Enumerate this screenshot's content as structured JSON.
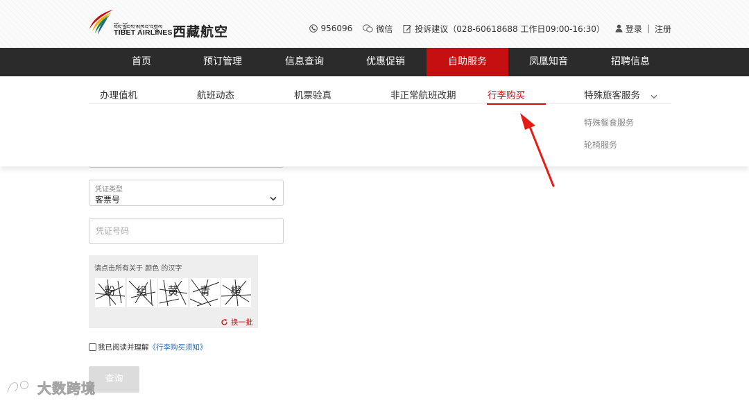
{
  "header": {
    "logo_tibetan": "བོད་ལྗོངས་མཁའ་འགྲུལ",
    "logo_en": "TIBET AIRLINES",
    "logo_cn": "西藏航空",
    "phone": "956096",
    "wechat": "微信",
    "complaint": "投诉建议（028-60618688 工作日09:00-16:30）",
    "login": "登录",
    "separator": "|",
    "register": "注册"
  },
  "nav": {
    "items": [
      {
        "label": "首页"
      },
      {
        "label": "预订管理"
      },
      {
        "label": "信息查询"
      },
      {
        "label": "优惠促销"
      },
      {
        "label": "自助服务"
      },
      {
        "label": "凤凰知音"
      },
      {
        "label": "招聘信息"
      }
    ],
    "active_index": 4
  },
  "subnav": {
    "items": [
      {
        "label": "办理值机"
      },
      {
        "label": "航班动态"
      },
      {
        "label": "机票验真"
      },
      {
        "label": "非正常航班改期"
      },
      {
        "label": "行李购买"
      },
      {
        "label": "特殊旅客服务"
      }
    ],
    "active_index": 4,
    "special_children": [
      "特殊餐食服务",
      "轮椅服务"
    ]
  },
  "form": {
    "voucher_type_label": "凭证类型",
    "voucher_type_value": "客票号",
    "voucher_number_placeholder": "凭证号码",
    "captcha_prompt": "请点击所有关于 颜色 的汉字",
    "captcha_chars": [
      "粉",
      "组",
      "黄",
      "青",
      "橙"
    ],
    "refresh_label": "换一批",
    "agree_text": "我已阅读并理解",
    "agree_link": "《行李购买须知》",
    "query_button": "查询"
  },
  "watermark": {
    "text": "大数跨境"
  },
  "colors": {
    "brand_red": "#c50e10",
    "nav_bg": "#2b2b2b",
    "link_blue": "#2a6fb8"
  }
}
